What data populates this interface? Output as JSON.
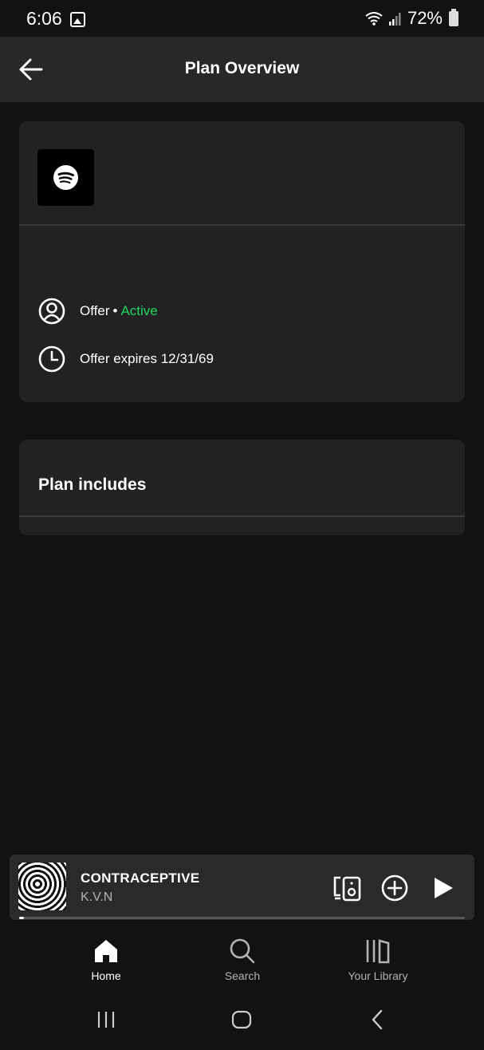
{
  "status_bar": {
    "time": "6:06",
    "battery": "72%"
  },
  "header": {
    "title": "Plan Overview",
    "back_icon": "arrow-left-icon"
  },
  "plan_card": {
    "logo_icon": "spotify-logo-icon",
    "status_label": "Offer",
    "status_separator": "•",
    "status_value": "Active",
    "status_color": "#1ed760",
    "expiry_text": "Offer expires 12/31/69"
  },
  "includes_card": {
    "heading": "Plan includes"
  },
  "now_playing": {
    "title": "CONTRACEPTIVE",
    "artist": "K.V.N",
    "progress": 0.01
  },
  "bottom_nav": {
    "items": [
      {
        "label": "Home",
        "icon": "home-icon",
        "active": true
      },
      {
        "label": "Search",
        "icon": "search-icon",
        "active": false
      },
      {
        "label": "Your Library",
        "icon": "library-icon",
        "active": false
      }
    ]
  }
}
